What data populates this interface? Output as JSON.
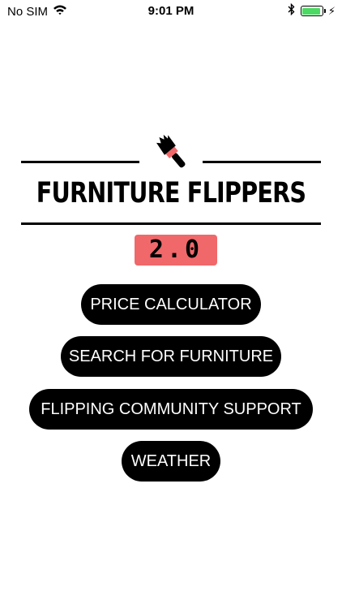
{
  "status_bar": {
    "carrier": "No SIM",
    "time": "9:01 PM",
    "battery_level": 1.0,
    "battery_color": "#4cd964",
    "icons": [
      "wifi-icon",
      "bluetooth-icon",
      "battery-icon",
      "charging-bolt-icon"
    ]
  },
  "logo": {
    "title": "FURNITURE FLIPPERS",
    "icon": "paintbrush-icon"
  },
  "version": {
    "label": "2.0",
    "color": "#f0686a"
  },
  "menu": {
    "buttons": [
      {
        "label": "PRICE CALCULATOR"
      },
      {
        "label": "SEARCH FOR FURNITURE"
      },
      {
        "label": "FLIPPING COMMUNITY SUPPORT"
      },
      {
        "label": "WEATHER"
      }
    ]
  }
}
